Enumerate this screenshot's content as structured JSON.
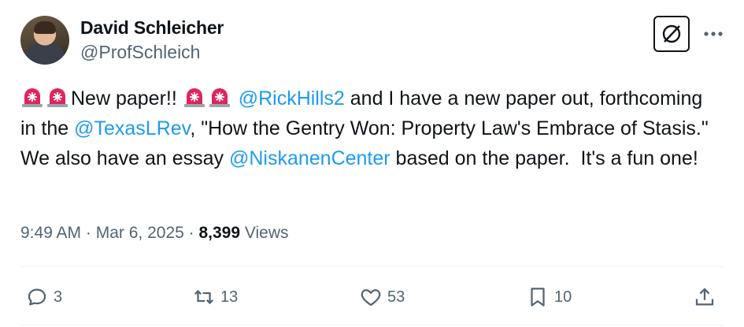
{
  "author": {
    "name": "David Schleicher",
    "handle": "@ProfSchleich"
  },
  "tweet": {
    "segments": [
      {
        "type": "emoji",
        "name": "siren-emoji"
      },
      {
        "type": "emoji",
        "name": "siren-emoji"
      },
      {
        "type": "text",
        "text": "New paper!! "
      },
      {
        "type": "emoji",
        "name": "siren-emoji"
      },
      {
        "type": "emoji",
        "name": "siren-emoji"
      },
      {
        "type": "text",
        "text": " "
      },
      {
        "type": "mention",
        "text": "@RickHills2"
      },
      {
        "type": "text",
        "text": " and I have a new paper out, forthcoming in the "
      },
      {
        "type": "mention",
        "text": "@TexasLRev"
      },
      {
        "type": "text",
        "text": ", \"How the Gentry Won: Property Law's Embrace of Stasis.\"  We also have an essay "
      },
      {
        "type": "mention",
        "text": "@NiskanenCenter"
      },
      {
        "type": "text",
        "text": " based on the paper.  It's a fun one!"
      }
    ]
  },
  "meta": {
    "time": "9:49 AM",
    "separator": " · ",
    "date": "Mar 6, 2025",
    "views_count": "8,399",
    "views_label": "Views"
  },
  "actions": {
    "replies": "3",
    "reposts": "13",
    "likes": "53",
    "bookmarks": "10"
  },
  "colors": {
    "link": "#1d9bf0",
    "secondary": "#536471",
    "primary": "#0f1419",
    "siren": "#e0245e"
  },
  "icons": [
    "grok-icon",
    "more-icon",
    "reply-icon",
    "repost-icon",
    "like-icon",
    "bookmark-icon",
    "share-icon"
  ]
}
